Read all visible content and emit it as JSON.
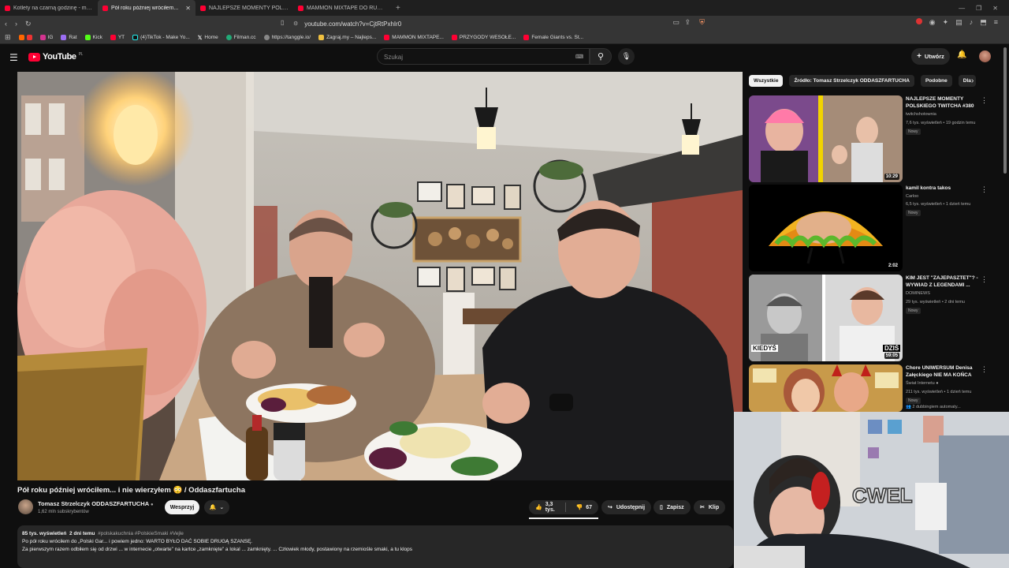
{
  "browser": {
    "tabs": [
      {
        "title": "Kotlety na czarną godzinę - mogą st..."
      },
      {
        "title": "Pół roku później wróciłem..."
      },
      {
        "title": "NAJLEPSZE MOMENTY POLSKIEGO T..."
      },
      {
        "title": "MAMMON MIXTAPE DO RUCH@NI..."
      }
    ],
    "new_tab": "+",
    "url": "youtube.com/watch?v=CjtRtPxhIr0",
    "bookmarks": [
      "IG",
      "Rat",
      "Kick",
      "YT",
      "(4)TikTok - Make Yo...",
      "Home",
      "Filman.cc",
      "https://tanggle.io/",
      "Zagraj.my – Najleps...",
      "MAMMON MIXTAPE...",
      "PRZYGODY WESOŁE...",
      "Female Giants vs. St..."
    ]
  },
  "header": {
    "logo_text": "YouTube",
    "country": "PL",
    "search_placeholder": "Szukaj",
    "create_label": "Utwórz"
  },
  "video": {
    "title": "Pół roku później wróciłem... i nie wierzyłem 😳 / Oddaszfartucha",
    "channel": "Tomasz Strzelczyk ODDASZFARTUCHA",
    "subscribers": "1,62 mln subskrybentów",
    "support_label": "Wesprzyj",
    "likes": "3,3 tys.",
    "dislikes": "67",
    "share_label": "Udostępnij",
    "save_label": "Zapisz",
    "clip_label": "Klip",
    "views": "85 tys. wyświetleń",
    "age": "2 dni temu",
    "tags": "#polskakuchnia #PolskieSmaki #Vejle",
    "desc_line1": "Po pół roku wróciłem do „Polski Gar... i powiem jedno: WARTO BYŁO DAĆ  SOBIE DRUGĄ SZANSĘ.",
    "desc_line2": "Za pierwszym razem odbiłem się od drzwi ... w internecie „otwarte” na kartce „zamknięte” a lokal ... zamknięty. ... Człowiek młody, postawiony na rzemiośle smaki, a tu klops"
  },
  "chips": [
    "Wszystkie",
    "Źródło: Tomasz Strzelczyk ODDASZFARTUCHA",
    "Podobne",
    "Dla"
  ],
  "recommendations": [
    {
      "title": "NAJLEPSZE MOMENTY POLSKIEGO TWITCHA #380",
      "channel": "twitchshotownia",
      "meta": "7,6 tys. wyświetleń • 19 godzin temu",
      "badge": "Nowy",
      "duration": "10:29"
    },
    {
      "title": "kamil kontra takos",
      "channel": "Carloo",
      "meta": "6,5 tys. wyświetleń • 1 dzień temu",
      "badge": "Nowy",
      "duration": "2:02"
    },
    {
      "title": "KIM JEST \"ZAJEPASZTET\"? - WYWIAD Z LEGENDAMI ...",
      "channel": "DOMINEWS",
      "meta": "29 tys. wyświetleń • 2 dni temu",
      "badge": "Nowy",
      "duration": "59:05",
      "left_label": "KIEDYŚ",
      "right_label": "DZIŚ"
    },
    {
      "title": "Chore UNIWERSUM Denisa Załęckiego NIE MA KOŃCA",
      "channel": "Świat Internetu",
      "meta": "211 tys. wyświetleń • 1 dzień temu",
      "badge": "Nowy",
      "extra": "2 dubbingiem automaty..."
    }
  ],
  "colors": {
    "bg": "#0f0f0f",
    "accent": "#ff0033",
    "chip_bg": "#272727"
  }
}
